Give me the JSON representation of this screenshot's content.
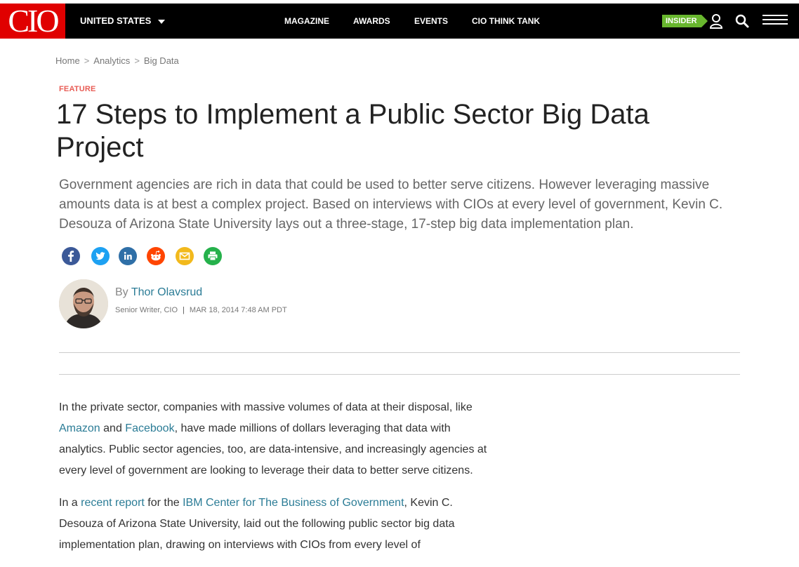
{
  "site": {
    "logo": "CIO",
    "edition": "UNITED STATES"
  },
  "nav": [
    {
      "label": "MAGAZINE"
    },
    {
      "label": "AWARDS"
    },
    {
      "label": "EVENTS"
    },
    {
      "label": "CIO THINK TANK"
    }
  ],
  "header": {
    "insider_label": "INSIDER"
  },
  "breadcrumb": [
    "Home",
    "Analytics",
    "Big Data"
  ],
  "article": {
    "kicker": "FEATURE",
    "title": "17 Steps to Implement a Public Sector Big Data Project",
    "dek": "Government agencies are rich in data that could be used to better serve citizens. However leveraging massive amounts data is at best a complex project. Based on interviews with CIOs at every level of government, Kevin C. Desouza of Arizona State University lays out a three-stage, 17-step big data implementation plan.",
    "byline_prefix": "By",
    "author": "Thor Olavsrud",
    "author_role": "Senior Writer, CIO",
    "meta_separator": "|",
    "date": "MAR 18, 2014 7:48 AM PDT"
  },
  "share_icons": [
    "facebook-icon",
    "twitter-icon",
    "linkedin-icon",
    "reddit-icon",
    "email-icon",
    "print-icon"
  ],
  "body": {
    "p1": {
      "before": "In the private sector, companies with massive volumes of data at their disposal, like ",
      "link1": "Amazon",
      "mid": " and ",
      "link2": "Facebook",
      "after": ", have made millions of dollars leveraging that data with analytics. Public sector agencies, too, are data-intensive, and increasingly agencies at every level of government are looking to leverage their data to better serve citizens."
    },
    "p2": {
      "before": "In a ",
      "link1": "recent report",
      "mid": " for the ",
      "link2": "IBM Center for The Business of Government",
      "after": ", Kevin C. Desouza of Arizona State University, laid out the following public sector big data implementation plan, drawing on interviews with CIOs from every level of"
    }
  },
  "colors": {
    "brand_red": "#e00000",
    "navbar": "#000000",
    "insider_green": "#68b72e",
    "kicker": "#e85c55",
    "link": "#2b7c96",
    "facebook": "#3b5998",
    "twitter": "#1da1f2",
    "linkedin": "#2f6fa7",
    "reddit": "#ff4500",
    "email": "#f2b91c",
    "print": "#25b14b"
  }
}
